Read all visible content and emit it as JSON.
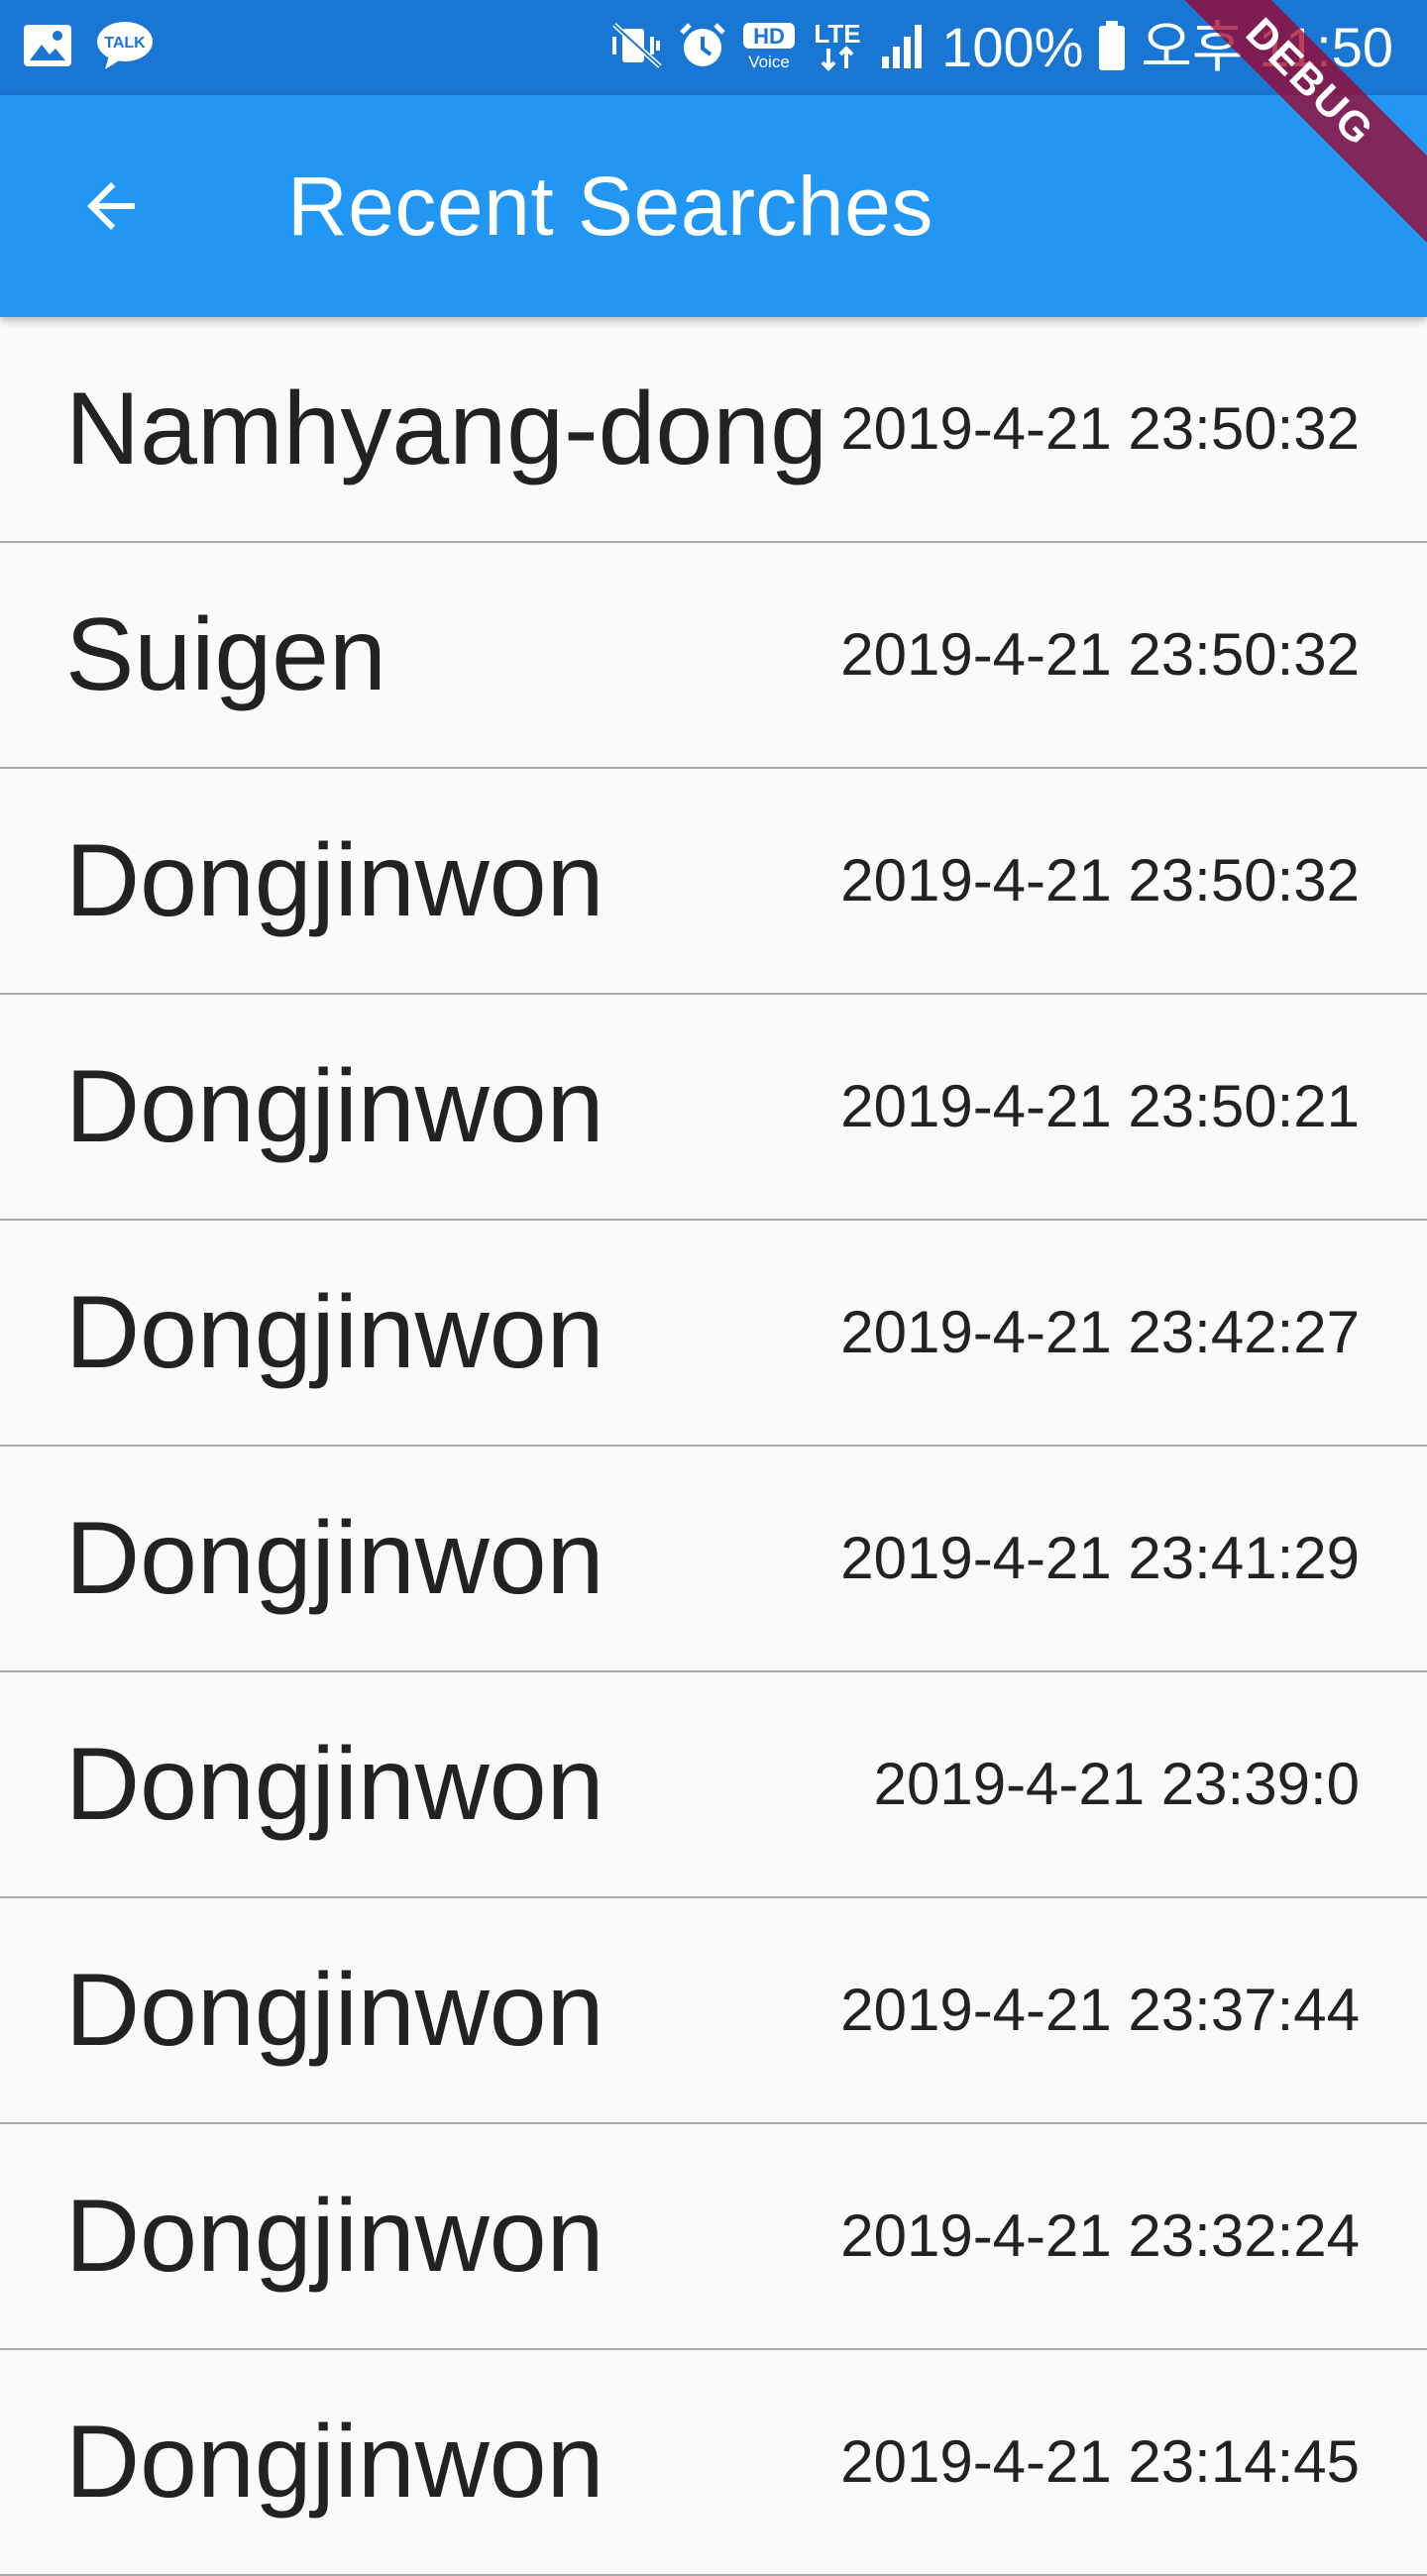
{
  "status_bar": {
    "left_icons": [
      "gallery-icon",
      "kakaotalk-icon"
    ],
    "talk_label": "TALK",
    "right_icons": [
      "vibrate-mute-icon",
      "alarm-icon",
      "hd-voice-icon",
      "lte-icon",
      "signal-icon",
      "battery-icon"
    ],
    "hd_label": "HD",
    "voice_label": "Voice",
    "lte_label": "LTE",
    "battery": "100%",
    "time": "오후 11:50"
  },
  "app_bar": {
    "title": "Recent Searches",
    "debug_banner": "DEBUG",
    "colors": {
      "app_bar": "#2196f3",
      "status_bar": "#1976d2"
    }
  },
  "searches": [
    {
      "name": "Namhyang-dong",
      "time": "2019-4-21 23:50:32"
    },
    {
      "name": "Suigen",
      "time": "2019-4-21 23:50:32"
    },
    {
      "name": "Dongjinwon",
      "time": "2019-4-21 23:50:32"
    },
    {
      "name": "Dongjinwon",
      "time": "2019-4-21 23:50:21"
    },
    {
      "name": "Dongjinwon",
      "time": "2019-4-21 23:42:27"
    },
    {
      "name": "Dongjinwon",
      "time": "2019-4-21 23:41:29"
    },
    {
      "name": "Dongjinwon",
      "time": "2019-4-21 23:39:0"
    },
    {
      "name": "Dongjinwon",
      "time": "2019-4-21 23:37:44"
    },
    {
      "name": "Dongjinwon",
      "time": "2019-4-21 23:32:24"
    },
    {
      "name": "Dongjinwon",
      "time": "2019-4-21 23:14:45"
    }
  ]
}
